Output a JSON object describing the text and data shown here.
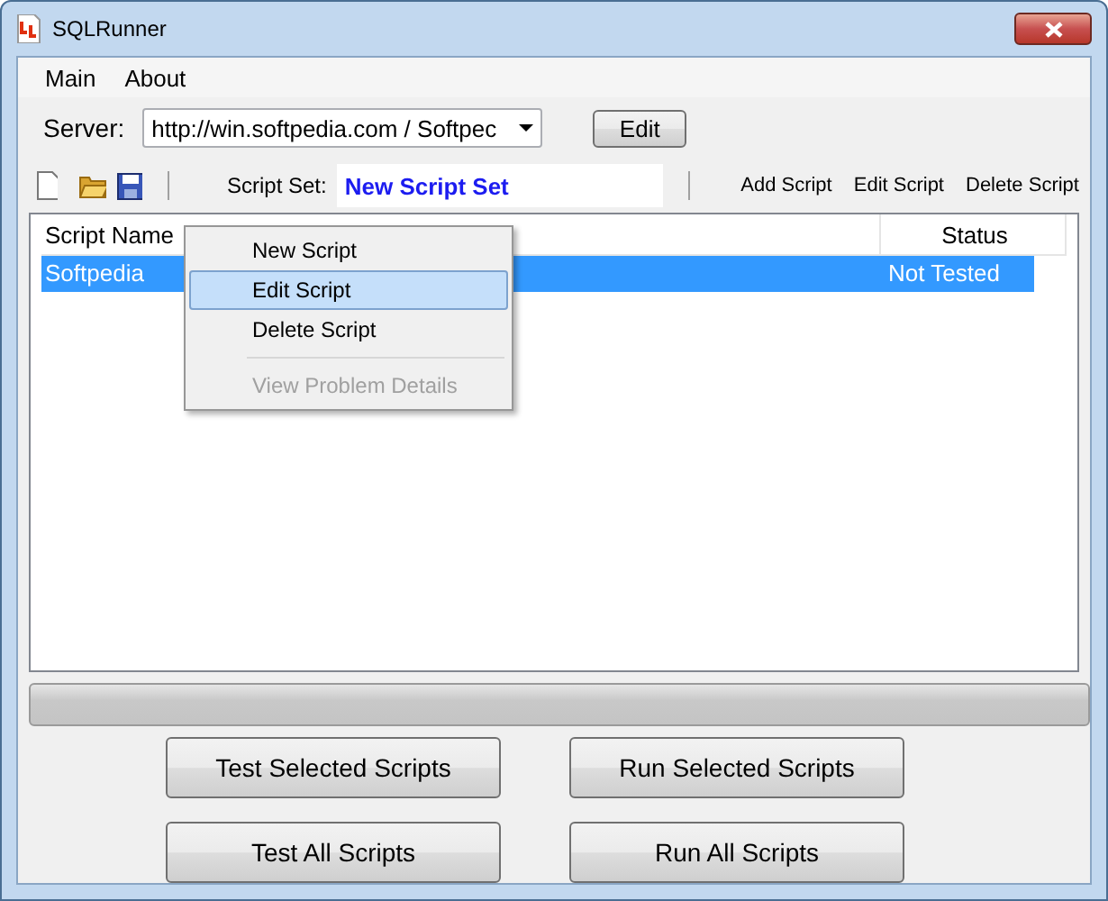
{
  "window": {
    "title": "SQLRunner"
  },
  "menu": [
    "Main",
    "About"
  ],
  "server": {
    "label": "Server:",
    "value": "http://win.softpedia.com / Softpec",
    "edit_button": "Edit"
  },
  "toolbar": {
    "script_set_label": "Script Set:",
    "script_set_value": "New Script Set",
    "actions": [
      "Add Script",
      "Edit Script",
      "Delete Script"
    ]
  },
  "table": {
    "columns": [
      "Script Name",
      "Status"
    ],
    "rows": [
      {
        "name": "Softpedia",
        "status": "Not Tested",
        "selected": true
      }
    ]
  },
  "context_menu": [
    {
      "label": "New Script",
      "selected": false,
      "disabled": false
    },
    {
      "label": "Edit Script",
      "selected": true,
      "disabled": false
    },
    {
      "label": "Delete Script",
      "selected": false,
      "disabled": false
    },
    {
      "label": "View Problem Details",
      "selected": false,
      "disabled": true,
      "separator_before": true
    }
  ],
  "progress": {
    "level": 0
  },
  "buttons": [
    [
      "Test Selected Scripts",
      "Run Selected Scripts"
    ],
    [
      "Test All Scripts",
      "Run All Scripts"
    ]
  ]
}
